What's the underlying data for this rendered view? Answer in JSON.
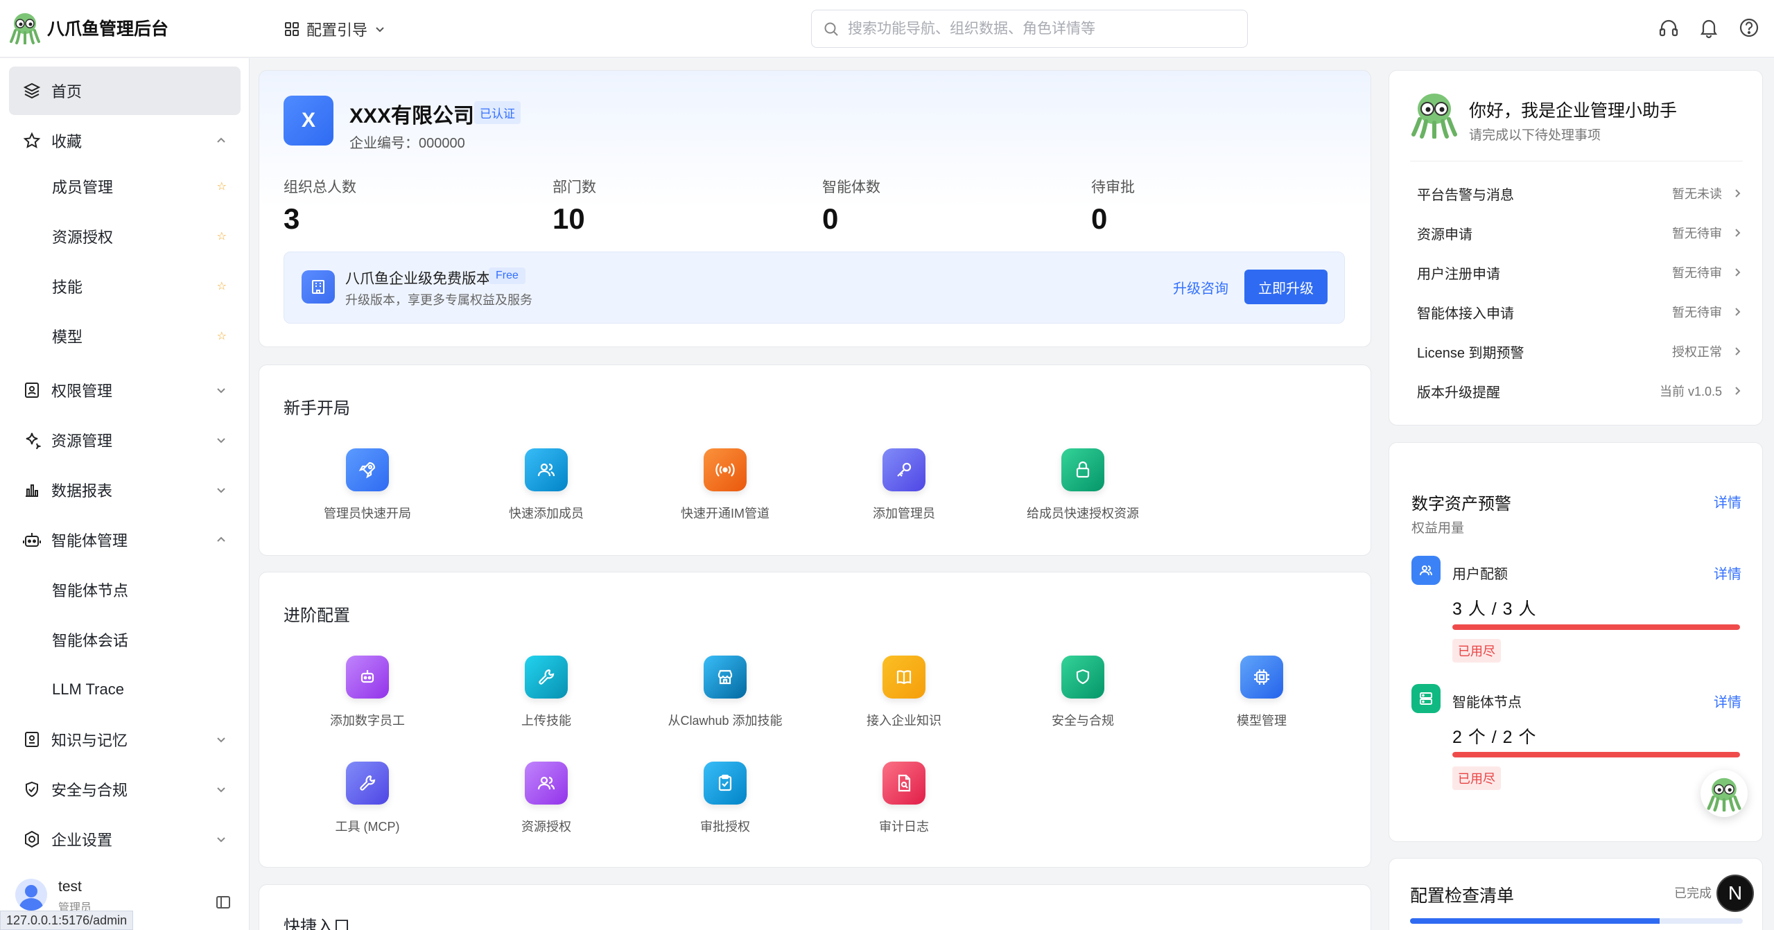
{
  "app": {
    "title": "八爪鱼管理后台"
  },
  "header": {
    "guide_label": "配置引导",
    "search_placeholder": "搜索功能导航、组织数据、角色详情等",
    "icons": [
      "headset-icon",
      "bell-icon",
      "help-icon"
    ]
  },
  "sidebar": {
    "items": [
      {
        "label": "首页",
        "icon": "layers-icon",
        "active": true
      },
      {
        "label": "收藏",
        "icon": "star-icon",
        "expanded": true
      },
      {
        "label": "成员管理",
        "sub": true,
        "starred": true
      },
      {
        "label": "资源授权",
        "sub": true,
        "starred": true
      },
      {
        "label": "技能",
        "sub": true,
        "starred": true
      },
      {
        "label": "模型",
        "sub": true,
        "starred": true
      },
      {
        "label": "权限管理",
        "icon": "id-card-icon"
      },
      {
        "label": "资源管理",
        "icon": "sparkle-icon"
      },
      {
        "label": "数据报表",
        "icon": "bar-chart-icon"
      },
      {
        "label": "智能体管理",
        "icon": "robot-icon",
        "expanded": true
      },
      {
        "label": "智能体节点",
        "sub": true
      },
      {
        "label": "智能体会话",
        "sub": true
      },
      {
        "label": "LLM Trace",
        "sub": true
      },
      {
        "label": "知识与记忆",
        "icon": "book-icon"
      },
      {
        "label": "安全与合规",
        "icon": "shield-check-icon"
      },
      {
        "label": "企业设置",
        "icon": "settings-icon"
      }
    ],
    "user": {
      "name": "test",
      "role": "管理员"
    },
    "status_url": "127.0.0.1:5176/admin"
  },
  "company": {
    "logo_letter": "X",
    "name": "XXX有限公司",
    "badge": "已认证",
    "id_label": "企业编号：000000",
    "stats": [
      {
        "label": "组织总人数",
        "value": "3"
      },
      {
        "label": "部门数",
        "value": "10"
      },
      {
        "label": "智能体数",
        "value": "0"
      },
      {
        "label": "待审批",
        "value": "0"
      }
    ],
    "upgrade": {
      "title": "八爪鱼企业级免费版本",
      "tag": "Free",
      "subtitle": "升级版本，享更多专属权益及服务",
      "consult": "升级咨询",
      "button": "立即升级"
    }
  },
  "starter": {
    "title": "新手开局",
    "items": [
      {
        "label": "管理员快速开局",
        "icon": "rocket-icon",
        "color": "#3b82f6"
      },
      {
        "label": "快速添加成员",
        "icon": "users-icon",
        "color": "#0ea5e9"
      },
      {
        "label": "快速开通IM管道",
        "icon": "broadcast-icon",
        "color": "#f97316"
      },
      {
        "label": "添加管理员",
        "icon": "key-icon",
        "color": "#6366f1"
      },
      {
        "label": "给成员快速授权资源",
        "icon": "lock-icon",
        "color": "#10b981"
      }
    ]
  },
  "advanced": {
    "title": "进阶配置",
    "items": [
      {
        "label": "添加数字员工",
        "icon": "robot-icon",
        "color": "#a855f7"
      },
      {
        "label": "上传技能",
        "icon": "wrench-icon",
        "color": "#06b6d4"
      },
      {
        "label": "从Clawhub 添加技能",
        "icon": "store-icon",
        "color": "#0ea5e9"
      },
      {
        "label": "接入企业知识",
        "icon": "book-icon",
        "color": "#f59e0b"
      },
      {
        "label": "安全与合规",
        "icon": "shield-icon",
        "color": "#10b981"
      },
      {
        "label": "模型管理",
        "icon": "chip-icon",
        "color": "#3b82f6"
      },
      {
        "label": "工具 (MCP)",
        "icon": "wrench-icon",
        "color": "#6366f1"
      },
      {
        "label": "资源授权",
        "icon": "users-icon",
        "color": "#a855f7"
      },
      {
        "label": "审批授权",
        "icon": "clipboard-check-icon",
        "color": "#0ea5e9"
      },
      {
        "label": "审计日志",
        "icon": "file-search-icon",
        "color": "#f43f5e"
      }
    ]
  },
  "quick_entry": {
    "title": "快捷入口"
  },
  "assistant": {
    "title": "你好，我是企业管理小助手",
    "subtitle": "请完成以下待处理事项",
    "todos": [
      {
        "label": "平台告警与消息",
        "value": "暂无未读"
      },
      {
        "label": "资源申请",
        "value": "暂无待审"
      },
      {
        "label": "用户注册申请",
        "value": "暂无待审"
      },
      {
        "label": "智能体接入申请",
        "value": "暂无待审"
      },
      {
        "label": "License 到期预警",
        "value": "授权正常"
      },
      {
        "label": "版本升级提醒",
        "value": "当前 v1.0.5"
      }
    ]
  },
  "assets": {
    "title": "数字资产预警",
    "subtitle": "权益用量",
    "link": "详情",
    "items": [
      {
        "name": "用户配额",
        "value": "3 人 / 3 人",
        "used_ratio": 1.0,
        "tag": "已用尽",
        "link": "详情",
        "icon": "users-icon",
        "color": "#3b82f6"
      },
      {
        "name": "智能体节点",
        "value": "2 个 / 2 个",
        "used_ratio": 1.0,
        "tag": "已用尽",
        "link": "详情",
        "icon": "server-icon",
        "color": "#10b981"
      }
    ]
  },
  "checklist": {
    "title": "配置检查清单",
    "status": "已完成",
    "progress": 0.75
  },
  "fab": {
    "letter": "N"
  }
}
